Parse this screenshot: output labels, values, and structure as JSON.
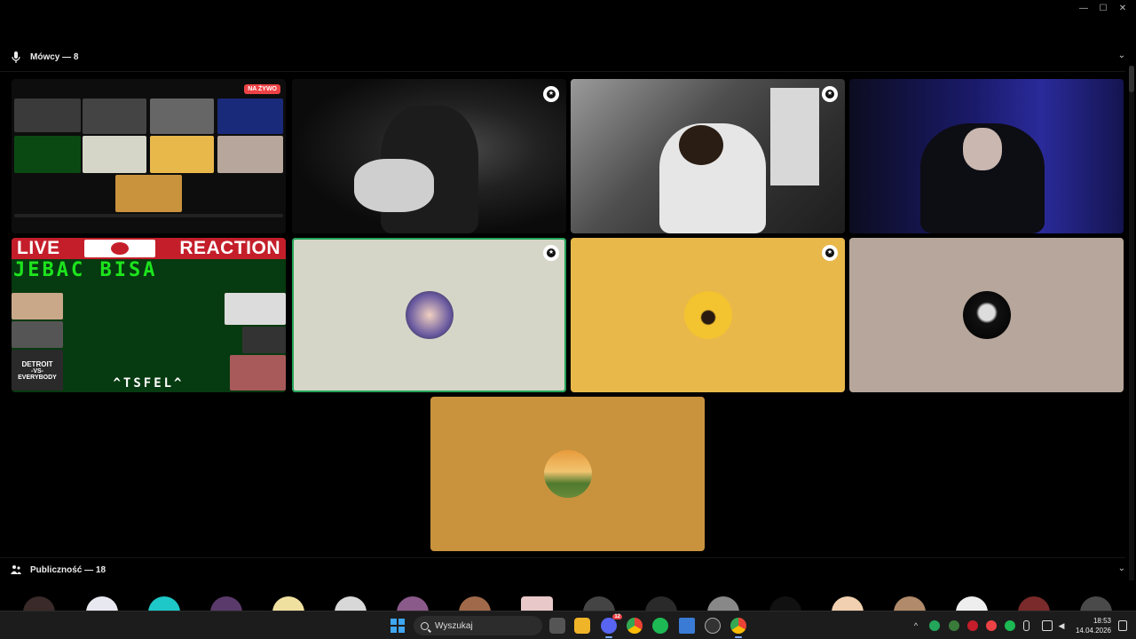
{
  "window": {
    "minimize": "—",
    "maximize": "☐",
    "close": "✕"
  },
  "speakers": {
    "title": "Mówcy — 8",
    "icon": "microphone-icon",
    "chevron": "⌄"
  },
  "tiles": {
    "screen_share": {
      "badge": "NA ŻYWO"
    },
    "stream": {
      "live": "LIVE",
      "reaction": "REACTION",
      "headline": "JEBAC BISA",
      "footer": "^TSFEL^",
      "detroit_line1": "DETROIT",
      "detroit_line2": "-VS-",
      "detroit_line3": "EVERYBODY"
    },
    "avatars": [
      {
        "bg": "#d6d6c8",
        "speaking": true
      },
      {
        "bg": "#e8b84a",
        "speaking": false
      },
      {
        "bg": "#b7a69b",
        "speaking": false
      },
      {
        "bg": "#c9933e",
        "speaking": false
      }
    ]
  },
  "audience": {
    "title": "Publiczność — 18",
    "icon": "audience-icon",
    "chevron": "⌄"
  },
  "taskbar": {
    "search_placeholder": "Wyszukaj",
    "time": "18:53",
    "date": "14.04.2026",
    "tray_chevron": "^",
    "discord_badge": "12"
  },
  "colors": {
    "speaking": "#23a55a",
    "live_red": "#ed4245",
    "accent": "#3fa6f0"
  }
}
